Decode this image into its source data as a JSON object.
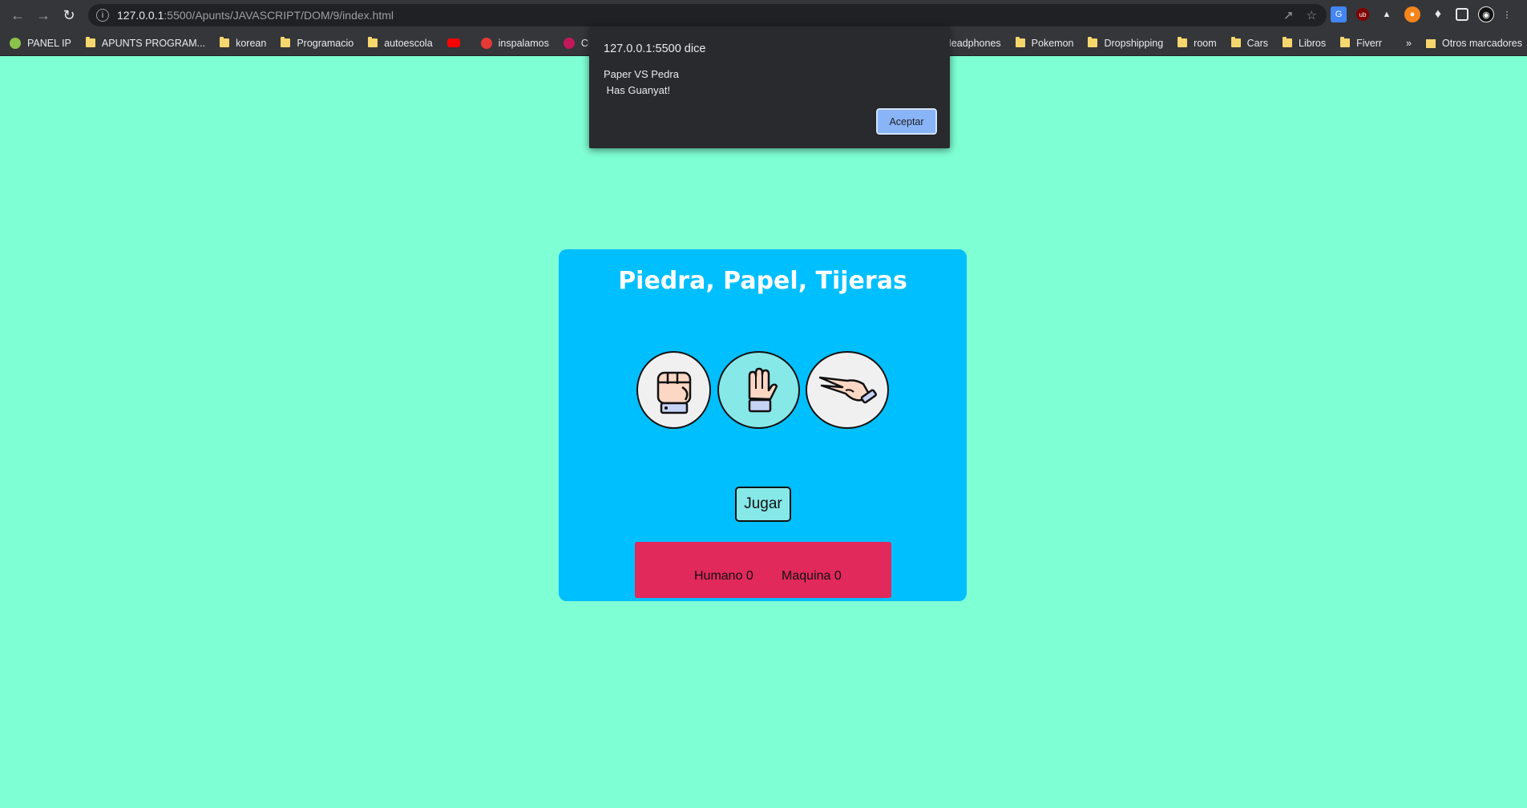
{
  "browser": {
    "url_host": "127.0.0.1",
    "url_path": ":5500/Apunts/JAVASCRIPT/DOM/9/index.html",
    "bookmarks": [
      {
        "label": "PANEL IP",
        "icon": "panel-ip-icon"
      },
      {
        "label": "APUNTS PROGRAM...",
        "icon": "folder-icon"
      },
      {
        "label": "korean",
        "icon": "folder-icon"
      },
      {
        "label": "Programacio",
        "icon": "folder-icon"
      },
      {
        "label": "autoescola",
        "icon": "folder-icon"
      },
      {
        "label": "",
        "icon": "youtube-icon"
      },
      {
        "label": "inspalamos",
        "icon": "inspalamos-icon"
      },
      {
        "label": "CLICEDU",
        "icon": "clicedu-icon"
      },
      {
        "label": "Headphones",
        "icon": "folder-icon"
      },
      {
        "label": "Pokemon",
        "icon": "folder-icon"
      },
      {
        "label": "Dropshipping",
        "icon": "folder-icon"
      },
      {
        "label": "room",
        "icon": "folder-icon"
      },
      {
        "label": "Cars",
        "icon": "folder-icon"
      },
      {
        "label": "Libros",
        "icon": "folder-icon"
      },
      {
        "label": "Fiverr",
        "icon": "folder-icon"
      }
    ],
    "more_bookmarks": "»",
    "other_bookmarks": "Otros marcadores"
  },
  "dialog": {
    "origin": "127.0.0.1:5500 dice",
    "message": "Paper VS Pedra\n Has Guanyat!",
    "ok_label": "Aceptar"
  },
  "game": {
    "title": "Piedra, Papel, Tijeras",
    "choices": [
      {
        "name": "rock",
        "selected": false
      },
      {
        "name": "paper",
        "selected": true
      },
      {
        "name": "scissors",
        "selected": false
      }
    ],
    "play_label": "Jugar",
    "score": {
      "human": "Humano 0",
      "machine": "Maquina 0"
    }
  },
  "colors": {
    "page_bg": "#7fffd4",
    "card_bg": "#00bfff",
    "score_bg": "#e1295b",
    "selected_bg": "#87e8e8"
  }
}
